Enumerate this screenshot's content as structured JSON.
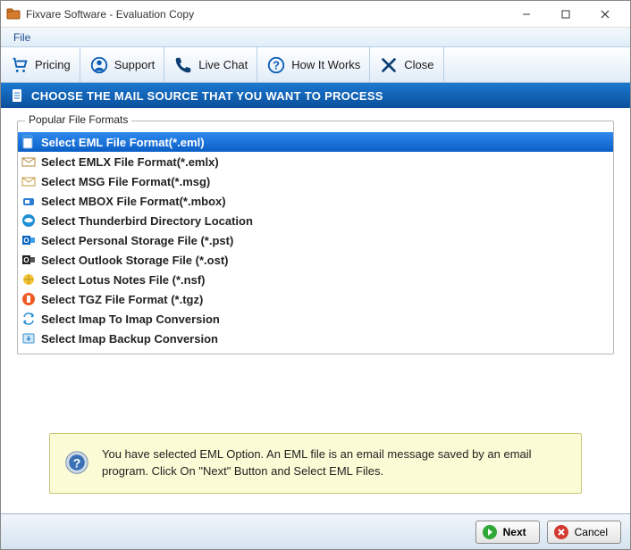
{
  "window": {
    "title": "Fixvare Software - Evaluation Copy"
  },
  "menubar": {
    "file": "File"
  },
  "toolbar": {
    "pricing": "Pricing",
    "support": "Support",
    "livechat": "Live Chat",
    "howitworks": "How It Works",
    "close": "Close"
  },
  "header": {
    "text": "CHOOSE THE MAIL SOURCE THAT YOU WANT TO PROCESS"
  },
  "groupbox": {
    "title": "Popular File Formats"
  },
  "formats": [
    {
      "label": "Select EML File Format(*.eml)"
    },
    {
      "label": "Select EMLX File Format(*.emlx)"
    },
    {
      "label": "Select MSG File Format(*.msg)"
    },
    {
      "label": "Select MBOX File Format(*.mbox)"
    },
    {
      "label": "Select Thunderbird Directory Location"
    },
    {
      "label": "Select Personal Storage File (*.pst)"
    },
    {
      "label": "Select Outlook Storage File (*.ost)"
    },
    {
      "label": "Select Lotus Notes File (*.nsf)"
    },
    {
      "label": "Select TGZ File Format (*.tgz)"
    },
    {
      "label": "Select Imap To Imap Conversion"
    },
    {
      "label": "Select Imap Backup Conversion"
    }
  ],
  "info": {
    "text": "You have selected EML Option. An EML file is an email message saved by an email program. Click On \"Next\" Button and Select EML Files."
  },
  "footer": {
    "next": "Next",
    "cancel": "Cancel"
  },
  "selected_index": 0
}
